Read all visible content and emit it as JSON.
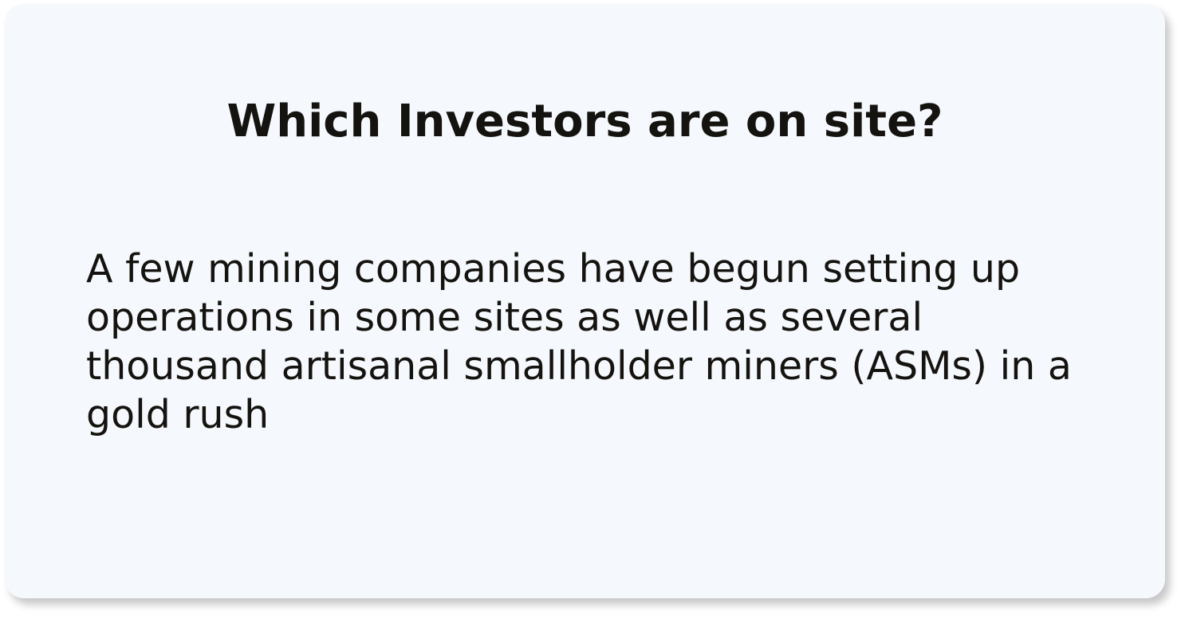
{
  "card": {
    "title": "Which Investors are on site?",
    "body": "A few mining companies have begun setting up operations in some sites as well as several thousand artisanal smallholder miners (ASMs) in a gold rush"
  },
  "colors": {
    "card_background": "#f5f8fc",
    "text": "#15130f"
  }
}
